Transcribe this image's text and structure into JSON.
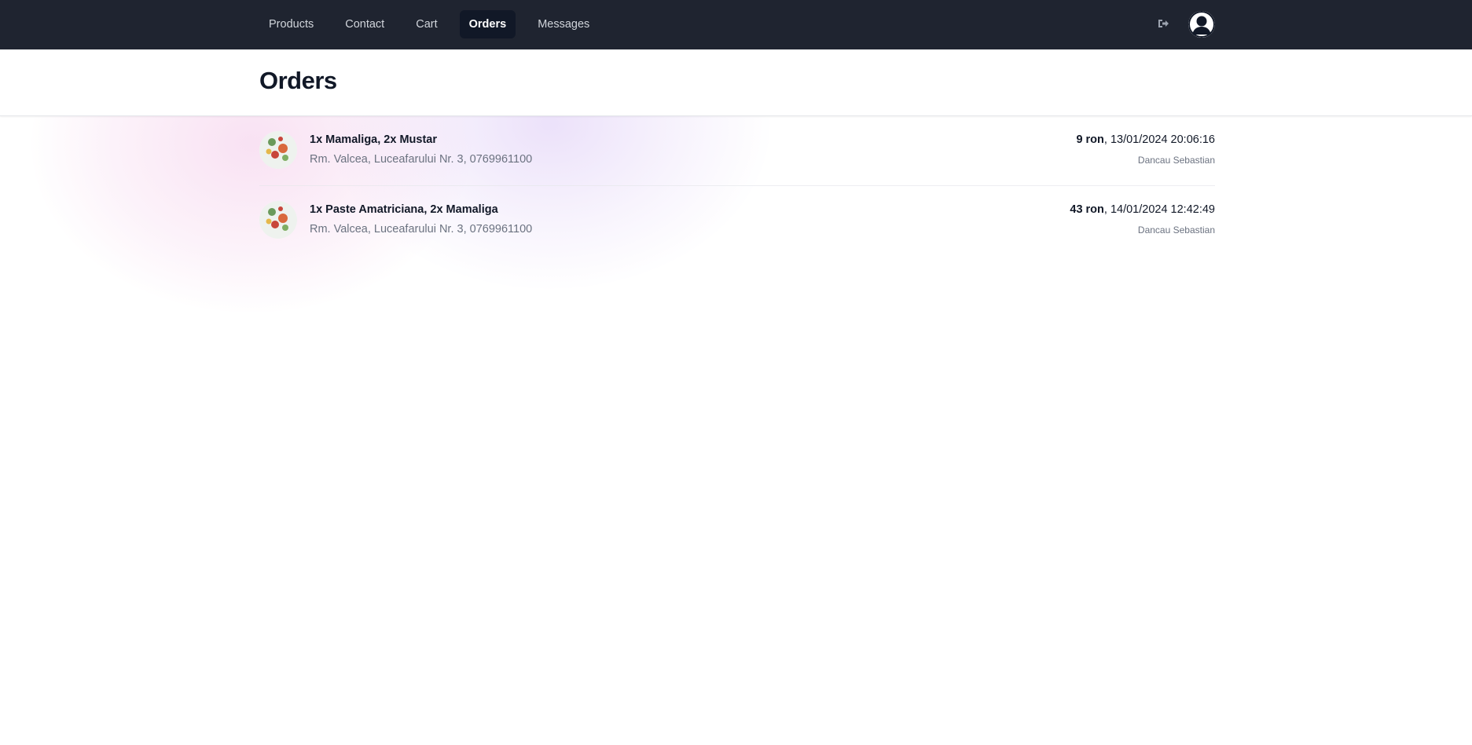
{
  "nav": {
    "links": [
      {
        "label": "Products",
        "active": false
      },
      {
        "label": "Contact",
        "active": false
      },
      {
        "label": "Cart",
        "active": false
      },
      {
        "label": "Orders",
        "active": true
      },
      {
        "label": "Messages",
        "active": false
      }
    ],
    "logout_icon": "logout-icon",
    "avatar_icon": "user-avatar-icon"
  },
  "header": {
    "title": "Orders"
  },
  "orders": [
    {
      "items": "1x Mamaliga, 2x Mustar",
      "address": "Rm. Valcea, Luceafarului Nr. 3, 0769961100",
      "price": "9 ron",
      "datetime": "13/01/2024 20:06:16",
      "customer": "Dancau Sebastian"
    },
    {
      "items": "1x Paste Amatriciana, 2x Mamaliga",
      "address": "Rm. Valcea, Luceafarului Nr. 3, 0769961100",
      "price": "43 ron",
      "datetime": "14/01/2024 12:42:49",
      "customer": "Dancau Sebastian"
    }
  ],
  "colors": {
    "navbar_bg": "#1f2430",
    "active_tab_bg": "#111827",
    "text_primary": "#111827",
    "text_secondary": "#6b7280"
  }
}
